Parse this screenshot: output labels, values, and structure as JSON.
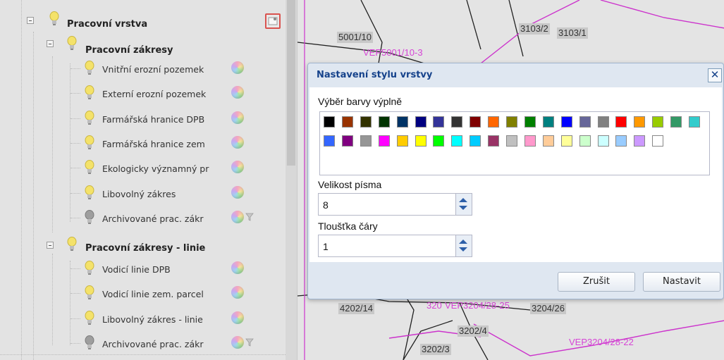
{
  "tree": {
    "groups": [
      {
        "label": "Pracovní vrstva"
      },
      {
        "label": "Pracovní zákresy"
      },
      {
        "label": "Pracovní zákresy - linie"
      }
    ],
    "layers_1": [
      {
        "label": "Vnitřní erozní pozemek",
        "active": true
      },
      {
        "label": "Externí erozní pozemek",
        "active": true
      },
      {
        "label": "Farmářská hranice DPB",
        "active": true
      },
      {
        "label": "Farmářská hranice zem",
        "active": true
      },
      {
        "label": "Ekologicky významný pr",
        "active": true
      },
      {
        "label": "Libovolný zákres",
        "active": true
      },
      {
        "label": "Archivované prac. zákr",
        "active": false
      }
    ],
    "layers_2": [
      {
        "label": "Vodicí linie DPB",
        "active": true
      },
      {
        "label": "Vodicí linie zem. parcel",
        "active": true
      },
      {
        "label": "Libovolný zákres - linie",
        "active": true
      },
      {
        "label": "Archivované prac. zákr",
        "active": false
      }
    ]
  },
  "map": {
    "labels": [
      "5001/10",
      "VEP5001/10-3",
      "3103/2",
      "3103/1",
      "4202/14",
      "320",
      "VEP3204/28-25",
      "3204/26",
      "3202/4",
      "3202/3",
      "VEP3204/28-22"
    ]
  },
  "dialog": {
    "title": "Nastavení stylu vrstvy",
    "close_label": "✕",
    "fill_color_label": "Výběr barvy výplně",
    "font_size_label": "Velikost písma",
    "font_size_value": "8",
    "line_width_label": "Tloušťka čáry",
    "line_width_value": "1",
    "cancel_label": "Zrušit",
    "apply_label": "Nastavit",
    "colors_row1": [
      "#000000",
      "#993300",
      "#333300",
      "#003300",
      "#003366",
      "#000080",
      "#333399",
      "#333333",
      "#800000",
      "#ff6600",
      "#808000",
      "#008000",
      "#008080",
      "#0000ff",
      "#666699",
      "#808080",
      "#ff0000",
      "#ff9900",
      "#99cc00",
      "#339966",
      "#33cccc"
    ],
    "colors_row2": [
      "#3366ff",
      "#800080",
      "#969696",
      "#ff00ff",
      "#ffcc00",
      "#ffff00",
      "#00ff00",
      "#00ffff",
      "#00ccff",
      "#993366",
      "#c0c0c0",
      "#ff99cc",
      "#ffcc99",
      "#ffff99",
      "#ccffcc",
      "#ccffff",
      "#99ccff",
      "#cc99ff",
      "#ffffff"
    ]
  }
}
